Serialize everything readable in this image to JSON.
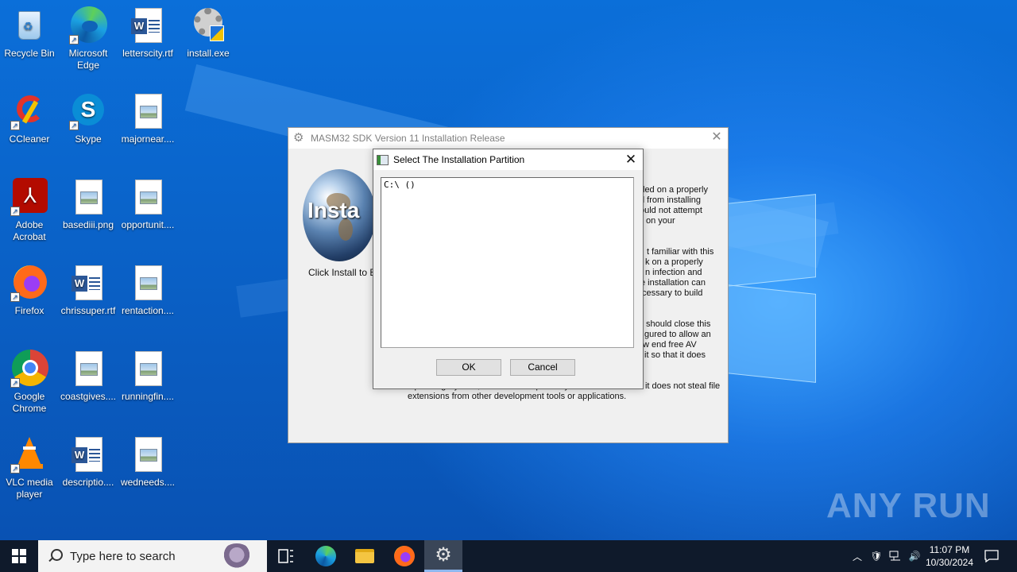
{
  "desktop": {
    "icons": [
      {
        "label": "Recycle Bin",
        "icon": "recycle-bin-icon"
      },
      {
        "label": "Microsoft Edge",
        "icon": "edge-icon"
      },
      {
        "label": "letterscity.rtf",
        "icon": "word-document-icon"
      },
      {
        "label": "install.exe",
        "icon": "installer-gear-icon"
      },
      {
        "label": "CCleaner",
        "icon": "ccleaner-icon"
      },
      {
        "label": "Skype",
        "icon": "skype-icon"
      },
      {
        "label": "majornear....",
        "icon": "image-file-icon"
      },
      {
        "label": "Adobe Acrobat",
        "icon": "acrobat-icon"
      },
      {
        "label": "basediii.png",
        "icon": "image-file-icon"
      },
      {
        "label": "opportunit....",
        "icon": "image-file-icon"
      },
      {
        "label": "Firefox",
        "icon": "firefox-icon"
      },
      {
        "label": "chrissuper.rtf",
        "icon": "word-document-icon"
      },
      {
        "label": "rentaction....",
        "icon": "image-file-icon"
      },
      {
        "label": "Google Chrome",
        "icon": "chrome-icon"
      },
      {
        "label": "coastgives....",
        "icon": "image-file-icon"
      },
      {
        "label": "runningfin....",
        "icon": "image-file-icon"
      },
      {
        "label": "VLC media player",
        "icon": "vlc-icon"
      },
      {
        "label": "descriptio....",
        "icon": "word-document-icon"
      },
      {
        "label": "wedneeds....",
        "icon": "image-file-icon"
      }
    ]
  },
  "main_window": {
    "title": "MASM32 SDK Version 11 Installation Release",
    "globe_text": "Insta",
    "click_note": "Click Install to Be",
    "para1": [
      "led on a properly",
      "d from installing",
      "ould not attempt",
      "on your"
    ],
    "para2": [
      "t familiar with this",
      "k on a properly",
      "n infection and",
      "e installation can",
      "cessary to build"
    ],
    "para3": [
      "should close this",
      "gured to allow an",
      "w end free AV",
      "it so that it does"
    ],
    "para4": [
      "Operating System, it does not require any run time DLLs and it does not steal file",
      "extensions from other development tools or applications."
    ]
  },
  "partition_dialog": {
    "title": "Select The Installation Partition",
    "list_items": [
      "C:\\ ()"
    ],
    "ok_label": "OK",
    "cancel_label": "Cancel"
  },
  "taskbar": {
    "search_placeholder": "Type here to search",
    "time": "11:07 PM",
    "date": "10/30/2024"
  },
  "watermark": "ANY RUN"
}
